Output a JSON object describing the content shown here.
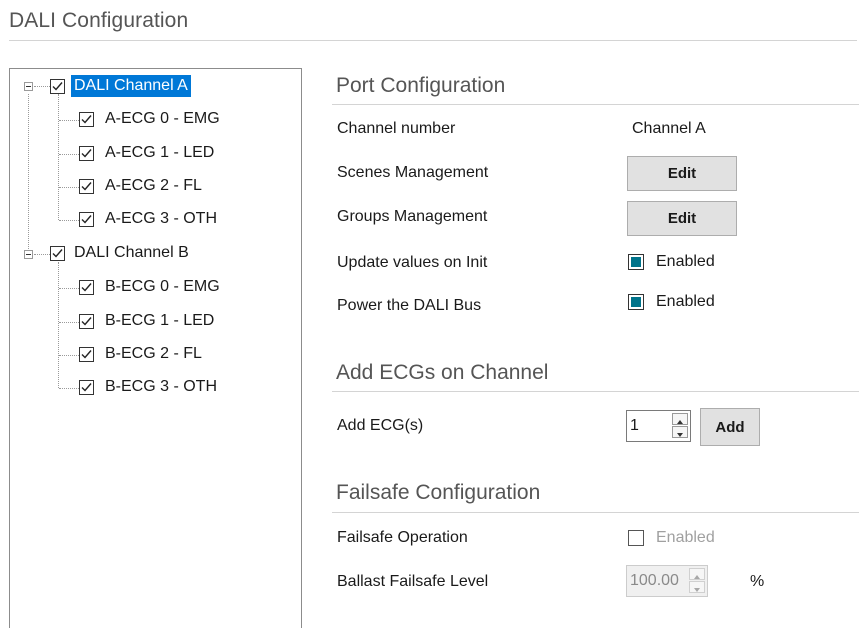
{
  "title": "DALI Configuration",
  "tree": {
    "channels": [
      {
        "label": "DALI Channel A",
        "checked": true,
        "selected": true,
        "ecgs": [
          {
            "label": "A-ECG 0 - EMG",
            "checked": true
          },
          {
            "label": "A-ECG 1 - LED",
            "checked": true
          },
          {
            "label": "A-ECG 2 - FL",
            "checked": true
          },
          {
            "label": "A-ECG 3 - OTH",
            "checked": true
          }
        ]
      },
      {
        "label": "DALI Channel B",
        "checked": true,
        "selected": false,
        "ecgs": [
          {
            "label": "B-ECG 0 - EMG",
            "checked": true
          },
          {
            "label": "B-ECG 1 - LED",
            "checked": true
          },
          {
            "label": "B-ECG 2 - FL",
            "checked": true
          },
          {
            "label": "B-ECG 3 - OTH",
            "checked": true
          }
        ]
      }
    ]
  },
  "port_config": {
    "title": "Port Configuration",
    "channel_number_label": "Channel number",
    "channel_number_value": "Channel A",
    "scenes_label": "Scenes Management",
    "scenes_button": "Edit",
    "groups_label": "Groups Management",
    "groups_button": "Edit",
    "update_label": "Update values on Init",
    "update_checked": true,
    "update_text": "Enabled",
    "power_label": "Power the DALI Bus",
    "power_checked": true,
    "power_text": "Enabled"
  },
  "add_ecgs": {
    "title": "Add ECGs on Channel",
    "label": "Add ECG(s)",
    "value": "1",
    "button": "Add"
  },
  "failsafe": {
    "title": "Failsafe Configuration",
    "operation_label": "Failsafe Operation",
    "operation_checked": false,
    "operation_text": "Enabled",
    "level_label": "Ballast Failsafe Level",
    "level_value": "100.00",
    "level_unit": "%"
  },
  "colors": {
    "selection": "#0078d7",
    "checkbox_fill": "#00738a",
    "section_title": "#555555"
  }
}
